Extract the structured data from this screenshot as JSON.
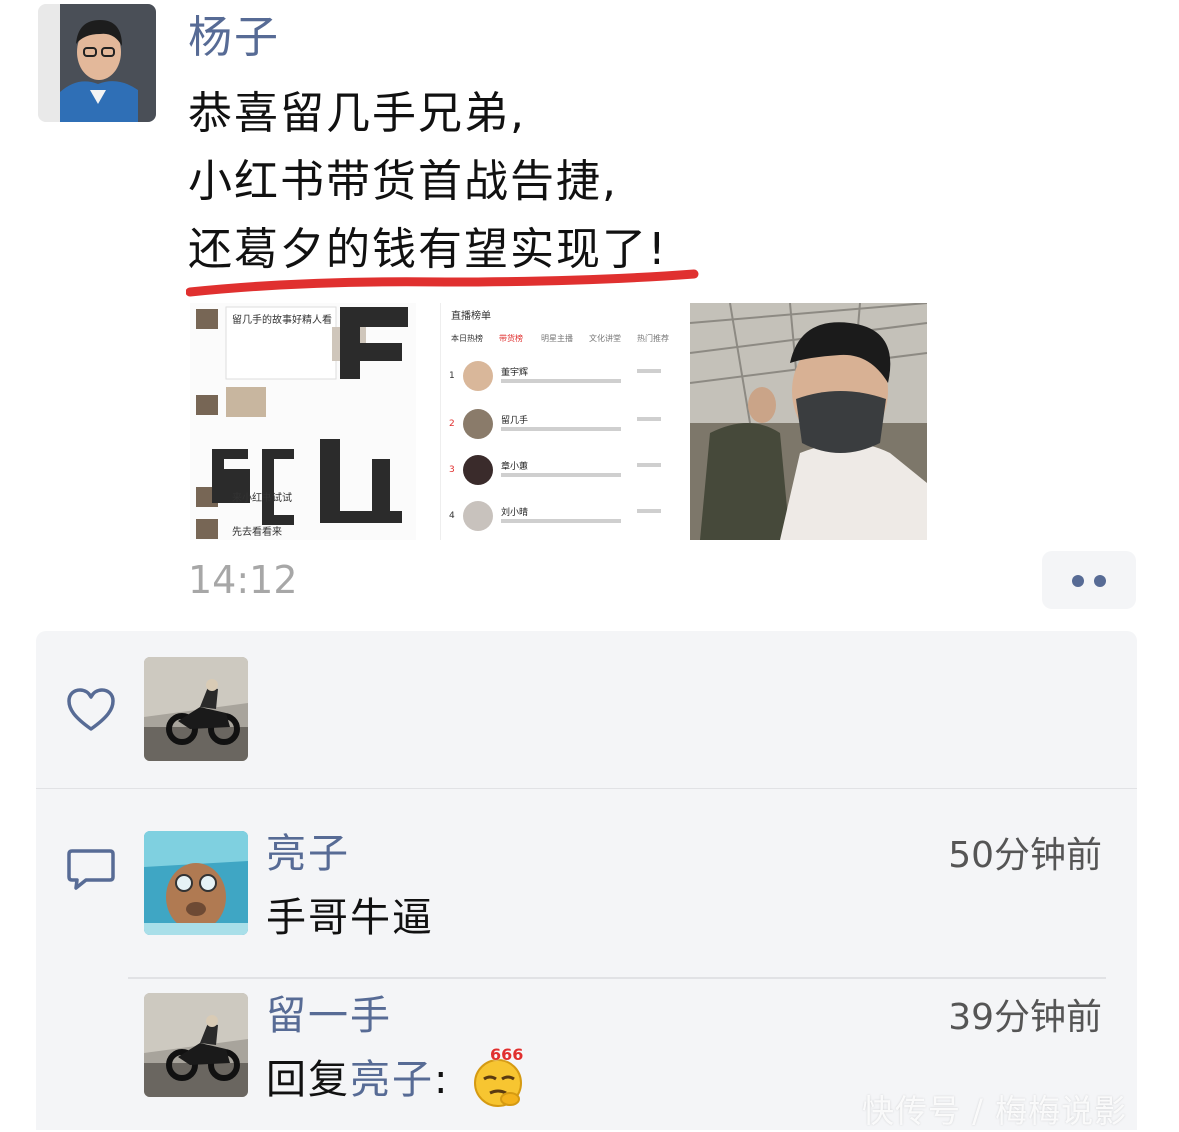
{
  "post": {
    "author": "杨子",
    "lines": [
      "恭喜留几手兄弟,",
      "小红书带货首战告捷,",
      "还葛夕的钱有望实现了!"
    ],
    "time": "14:12",
    "images": {
      "img1": {
        "lines": [
          "留几手的故事好精人看",
          "来小红书试试",
          "先去看看来"
        ]
      },
      "img2": {
        "header": "直播榜单",
        "tabs": [
          "本日热榜",
          "带货榜",
          "明星主播",
          "文化讲堂",
          "热门推荐"
        ],
        "rows": [
          {
            "rank": "1",
            "name": "董宇辉"
          },
          {
            "rank": "2",
            "name": "留几手"
          },
          {
            "rank": "3",
            "name": "章小蕙"
          },
          {
            "rank": "4",
            "name": "刘小晴"
          }
        ]
      }
    }
  },
  "interactions": {
    "comments": [
      {
        "name": "亮子",
        "time": "50分钟前",
        "text": "手哥牛逼"
      },
      {
        "name": "留一手",
        "time": "39分钟前",
        "reply_prefix": "回复",
        "reply_to": "亮子",
        "colon": ":",
        "emoji_badge": "666"
      }
    ]
  },
  "watermark": "快传号 / 梅梅说影",
  "colors": {
    "link": "#576b95",
    "panel": "#f4f5f7",
    "underline": "#e0302f"
  }
}
